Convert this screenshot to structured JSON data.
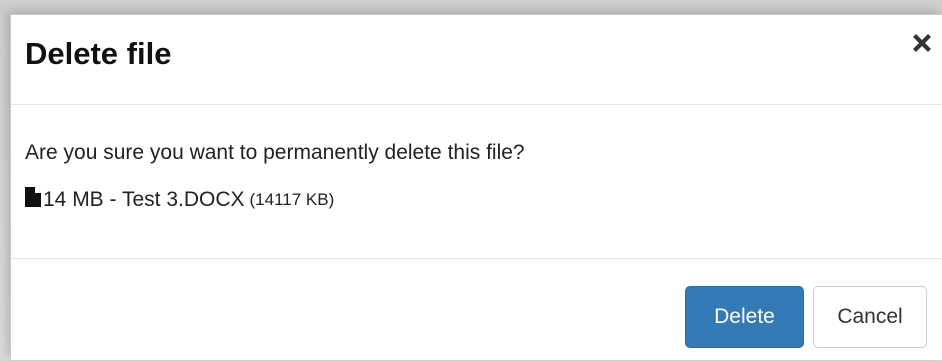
{
  "dialog": {
    "title": "Delete file",
    "close_icon": "close-icon"
  },
  "body": {
    "message": "Are you sure you want to permanently delete this file?",
    "file_icon": "file-icon",
    "file_name": "14 MB - Test 3.DOCX",
    "file_size": "(14117 KB)"
  },
  "footer": {
    "delete_label": "Delete",
    "cancel_label": "Cancel"
  },
  "colors": {
    "primary": "#337ab7",
    "primary_border": "#2e6da4",
    "text": "#222222"
  }
}
